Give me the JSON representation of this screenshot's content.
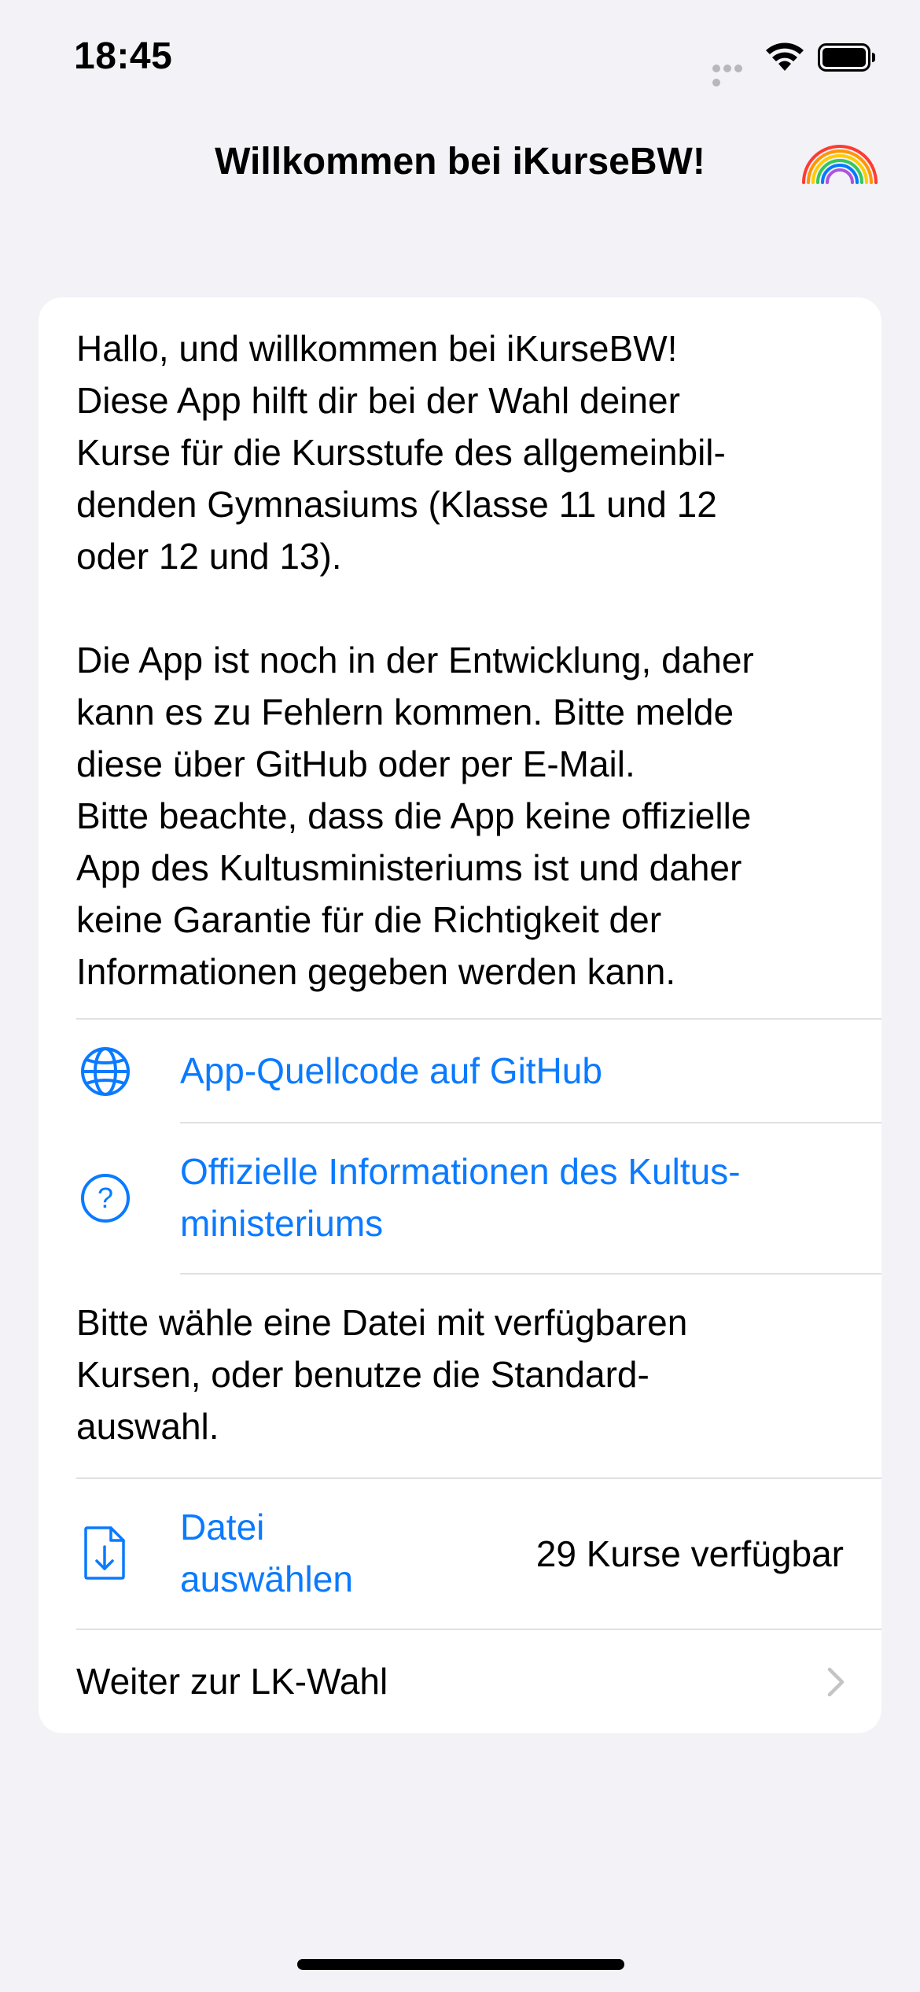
{
  "status_bar": {
    "time": "18:45"
  },
  "nav": {
    "title": "Willkommen bei iKurseBW!",
    "rainbow_icon": "rainbow-icon"
  },
  "card": {
    "intro": "Hallo, und willkommen bei iKurseBW!\nDiese App hilft dir bei der Wahl deiner\nKurse für die Kursstufe des allgemeinbil-\ndenden Gymnasiums (Klasse 11 und 12\noder 12 und 13).\n\nDie App ist noch in der Entwicklung, daher\nkann es zu Fehlern kommen. Bitte melde\ndiese über GitHub oder per E-Mail.\nBitte beachte, dass die App keine offizielle\nApp des Kultusministeriums ist und daher\nkeine Garantie für die Richtigkeit der\nInformationen gegeben werden kann.",
    "github_link": {
      "label": "App-Quellcode auf GitHub",
      "icon": "globe-icon"
    },
    "ministry_link": {
      "label": "Offizielle Informationen des Kultus-\nministeriums",
      "icon": "question-circle-icon"
    },
    "choose_text": "Bitte wähle eine Datei mit verfügbaren\nKursen, oder benutze die Standard-\nauswahl.",
    "file_select": {
      "label": "Datei\nauswählen",
      "icon": "document-download-icon",
      "count": "29 Kurse verfügbar"
    },
    "continue": {
      "label": "Weiter zur LK-Wahl",
      "icon": "chevron-right-icon"
    }
  },
  "colors": {
    "accent": "#0a7aff",
    "background": "#f2f2f7",
    "card": "#ffffff",
    "separator": "#e0e0e4",
    "chevron": "#c4c4c7"
  }
}
